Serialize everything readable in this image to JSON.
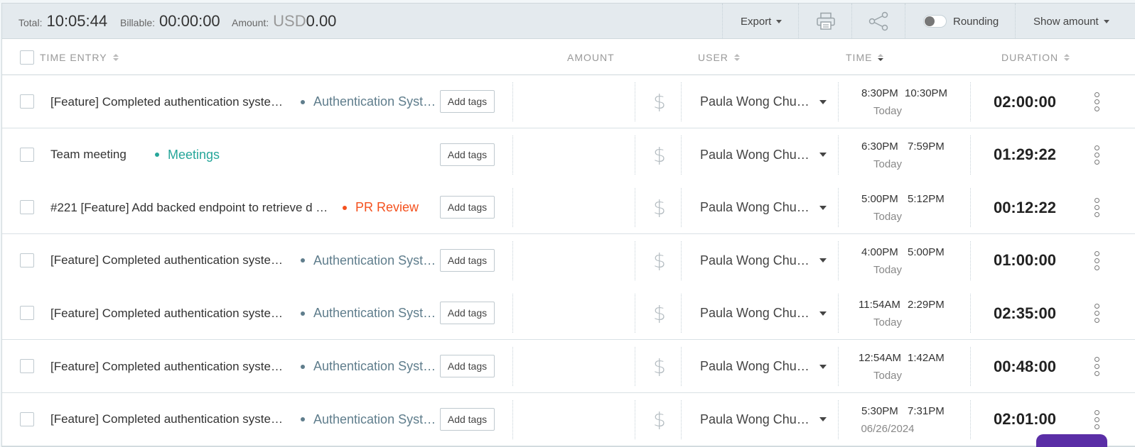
{
  "summary": {
    "total_label": "Total:",
    "total_value": "10:05:44",
    "billable_label": "Billable:",
    "billable_value": "00:00:00",
    "amount_label": "Amount:",
    "amount_currency": "USD",
    "amount_value": "0.00"
  },
  "toolbar": {
    "export_label": "Export",
    "print_icon": "printer-icon",
    "share_icon": "share-icon",
    "rounding_label": "Rounding",
    "rounding_on": false,
    "show_amount_label": "Show amount"
  },
  "columns": {
    "time_entry": "TIME ENTRY",
    "amount": "AMOUNT",
    "user": "USER",
    "time": "TIME",
    "duration": "DURATION"
  },
  "rows": [
    {
      "description": "[Feature] Completed authentication syste…",
      "project": "Authentication Syst…",
      "project_color": "#5f7d8c",
      "tags_label": "Add tags",
      "user": "Paula Wong Chu…",
      "start": "8:30PM",
      "end": "10:30PM",
      "date": "Today",
      "duration": "02:00:00"
    },
    {
      "description": "Team meeting",
      "project": "Meetings",
      "project_color": "#26a69a",
      "tags_label": "Add tags",
      "user": "Paula Wong Chu…",
      "start": "6:30PM",
      "end": "7:59PM",
      "date": "Today",
      "duration": "01:29:22"
    },
    {
      "description": "#221 [Feature] Add backed endpoint to retrieve d …",
      "project": "PR Review",
      "project_color": "#f4511e",
      "tags_label": "Add tags",
      "user": "Paula Wong Chu…",
      "start": "5:00PM",
      "end": "5:12PM",
      "date": "Today",
      "duration": "00:12:22"
    },
    {
      "description": "[Feature] Completed authentication syste…",
      "project": "Authentication Syst…",
      "project_color": "#5f7d8c",
      "tags_label": "Add tags",
      "user": "Paula Wong Chu…",
      "start": "4:00PM",
      "end": "5:00PM",
      "date": "Today",
      "duration": "01:00:00"
    },
    {
      "description": "[Feature] Completed authentication syste…",
      "project": "Authentication Syst…",
      "project_color": "#5f7d8c",
      "tags_label": "Add tags",
      "user": "Paula Wong Chu…",
      "start": "11:54AM",
      "end": "2:29PM",
      "date": "Today",
      "duration": "02:35:00"
    },
    {
      "description": "[Feature] Completed authentication syste…",
      "project": "Authentication Syst…",
      "project_color": "#5f7d8c",
      "tags_label": "Add tags",
      "user": "Paula Wong Chu…",
      "start": "12:54AM",
      "end": "1:42AM",
      "date": "Today",
      "duration": "00:48:00"
    },
    {
      "description": "[Feature] Completed authentication syste…",
      "project": "Authentication Syst…",
      "project_color": "#5f7d8c",
      "tags_label": "Add tags",
      "user": "Paula Wong Chu…",
      "start": "5:30PM",
      "end": "7:31PM",
      "date": "06/26/2024",
      "duration": "02:01:00"
    }
  ]
}
